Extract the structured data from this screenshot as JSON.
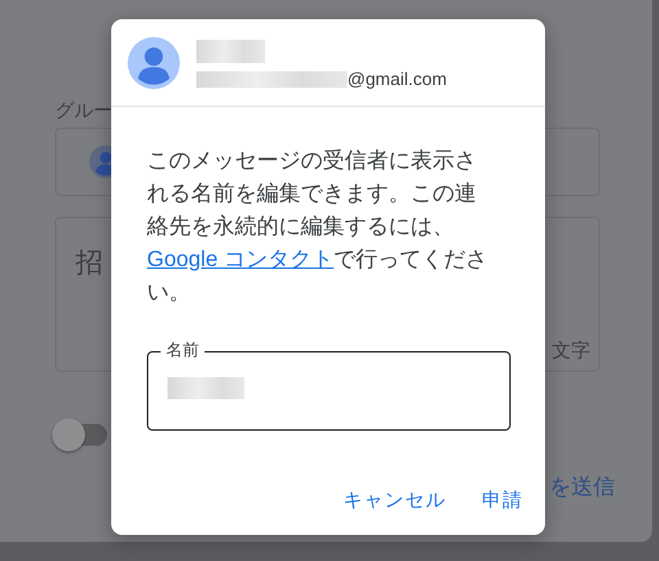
{
  "background": {
    "group_label": "グルー",
    "invite_label": "招",
    "char_count_label": "文字",
    "send_label": "を送信",
    "toggle": {
      "checked": false
    }
  },
  "dialog": {
    "email_suffix": "@gmail.com",
    "body": {
      "before": "このメッセージの受信者に表示される名前を編集できます。この連絡先を永続的に編集するには、",
      "link": "Google コンタクト",
      "after": "で行ってください。"
    },
    "field": {
      "label": "名前"
    },
    "buttons": [
      "キャンセル",
      "申請"
    ]
  }
}
